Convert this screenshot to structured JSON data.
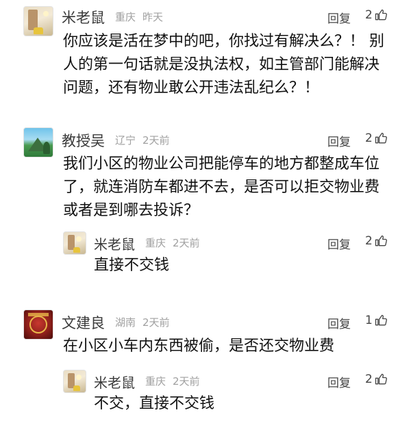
{
  "reply_label": "回复",
  "icons": {
    "like": "thumbs-up-icon"
  },
  "comments": [
    {
      "user": "米老鼠",
      "location": "重庆",
      "time": "昨天",
      "likes": "2",
      "text": "你应该是活在梦中的吧，你找过有解决么？！ 别人的第一句话就是没执法权，如主管部门能解决问题，还有物业敢公开违法乱纪么？！"
    },
    {
      "user": "教授吴",
      "location": "辽宁",
      "time": "2天前",
      "likes": "2",
      "text": "我们小区的物业公司把能停车的地方都整成车位了，就连消防车都进不去，是否可以拒交物业费或者是到哪去投诉？",
      "reply": {
        "user": "米老鼠",
        "location": "重庆",
        "time": "2天前",
        "likes": "2",
        "text": "直接不交钱"
      }
    },
    {
      "user": "文建良",
      "location": "湖南",
      "time": "2天前",
      "likes": "1",
      "text": "在小区小车内东西被偷，是否还交物业费",
      "reply": {
        "user": "米老鼠",
        "location": "重庆",
        "time": "2天前",
        "likes": "2",
        "text": "不交，直接不交钱"
      }
    }
  ]
}
